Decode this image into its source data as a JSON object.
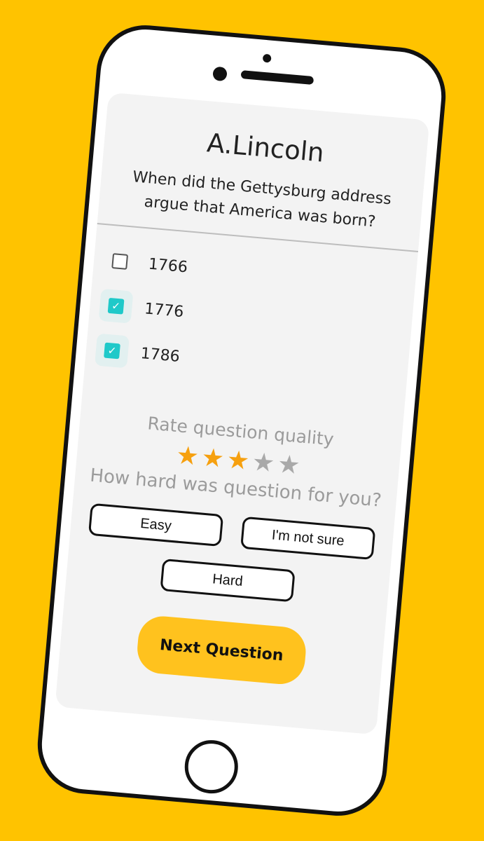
{
  "quiz": {
    "title": "A.Lincoln",
    "question": "When did the Gettysburg address argue that America was born?",
    "options": [
      {
        "label": "1766",
        "checked": false
      },
      {
        "label": "1776",
        "checked": true
      },
      {
        "label": "1786",
        "checked": true
      }
    ]
  },
  "rating": {
    "label": "Rate question quality",
    "value": 3,
    "max": 5
  },
  "difficulty": {
    "label": "How hard was question for you?",
    "easy_label": "Easy",
    "unsure_label": "I'm not sure",
    "hard_label": "Hard"
  },
  "actions": {
    "next_label": "Next Question"
  },
  "colors": {
    "background": "#FFC300",
    "accent": "#FFC21E",
    "checkbox_checked": "#1FC9C9",
    "star_on": "#F6A00F",
    "star_off": "#A9A9A9"
  },
  "icons": {
    "check": "check-icon",
    "star": "star-icon"
  }
}
